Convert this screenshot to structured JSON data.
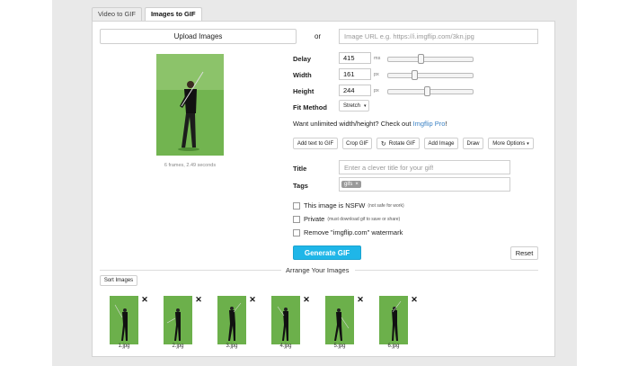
{
  "tabs": [
    {
      "label": "Video to GIF",
      "active": false
    },
    {
      "label": "Images to GIF",
      "active": true
    }
  ],
  "upload": {
    "button": "Upload Images",
    "or": "or",
    "url_placeholder": "Image URL e.g. https://i.imgflip.com/3kn.jpg"
  },
  "preview": {
    "caption": "6 frames, 2.49 seconds"
  },
  "settings": {
    "delay": {
      "label": "Delay",
      "value": "415",
      "unit": "ms",
      "slider_fraction": 0.28
    },
    "width": {
      "label": "Width",
      "value": "161",
      "unit": "px",
      "slider_fraction": 0.2
    },
    "height": {
      "label": "Height",
      "value": "244",
      "unit": "px",
      "slider_fraction": 0.3
    },
    "fit": {
      "label": "Fit Method",
      "value": "Stretch"
    }
  },
  "promo": {
    "text": "Want unlimited width/height? Check out ",
    "link": "Imgflip Pro",
    "end": "!"
  },
  "toolbar": {
    "add_text": "Add text to GIF",
    "crop": "Crop GIF",
    "rotate": "Rotate GIF",
    "add_image": "Add Image",
    "draw": "Draw",
    "more": "More Options"
  },
  "form": {
    "title_label": "Title",
    "title_placeholder": "Enter a clever title for your gif!",
    "tags_label": "Tags",
    "tag": "gifs"
  },
  "options": {
    "nsfw": {
      "label": "This image is NSFW",
      "note": "(not safe for work)"
    },
    "private": {
      "label": "Private",
      "note": "(must download gif to save or share)"
    },
    "watermark": {
      "label": "Remove \"imgflip.com\" watermark"
    }
  },
  "actions": {
    "generate": "Generate GIF",
    "reset": "Reset"
  },
  "arrange": {
    "heading": "Arrange Your Images",
    "sort": "Sort Images",
    "frames": [
      "1.jpg",
      "2.jpg",
      "3.jpg",
      "4.jpg",
      "5.jpg",
      "6.jpg"
    ]
  },
  "colors": {
    "accent": "#1fb6e8",
    "grass": "#6cb04b",
    "link": "#3b82c4"
  }
}
